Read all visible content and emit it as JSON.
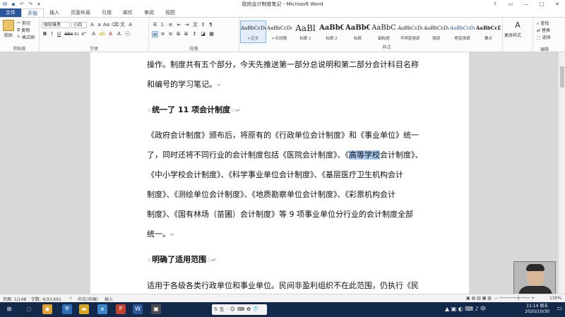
{
  "window": {
    "title": "政府会计制度笔记 - Microsoft Word",
    "controls": [
      "?",
      "▭",
      "—",
      "□",
      "✕"
    ]
  },
  "ribbon_tabs": [
    "文件",
    "开始",
    "插入",
    "页面布局",
    "引用",
    "邮件",
    "审阅",
    "视图"
  ],
  "clipboard": {
    "paste": "粘贴",
    "cut": "剪切",
    "copy": "复制",
    "format_painter": "格式刷",
    "group_label": "剪贴板"
  },
  "font": {
    "name": "微软雅黑",
    "size": "小四",
    "group_label": "字体"
  },
  "paragraph": {
    "group_label": "段落"
  },
  "styles": {
    "items": [
      {
        "sample": "AaBbCcDd",
        "name": "↵正文"
      },
      {
        "sample": "AaBbCcDd",
        "name": "↵无间隔"
      },
      {
        "sample": "AaBl",
        "name": "标题 1"
      },
      {
        "sample": "AaBbC",
        "name": "标题 2"
      },
      {
        "sample": "AaBbC",
        "name": "标题"
      },
      {
        "sample": "AaBbC",
        "name": "副标题"
      },
      {
        "sample": "AaBbCcDd",
        "name": "不明显强调"
      },
      {
        "sample": "AaBbCcDd",
        "name": "强调"
      },
      {
        "sample": "AaBbCcDc",
        "name": "明显强调"
      },
      {
        "sample": "AaBbCcDd",
        "name": "要点"
      }
    ],
    "change_styles": "更改样式",
    "group_label": "样式"
  },
  "editing": {
    "find": "查找",
    "replace": "替换",
    "select": "选择",
    "group_label": "编辑"
  },
  "document": {
    "lines": [
      {
        "text": "操作。制度共有五个部分，今天先推送第一部分总说明和第二部分会计科目名称"
      },
      {
        "text": "和编号的学习笔记。",
        "mark": "↵"
      },
      {
        "text": "统一了 11 项会计制度",
        "lead": "☆",
        "trail": "☆",
        "mark": "↵"
      },
      {
        "text": "《政府会计制度》颁布后，将原有的《行政单位会计制度》和《事业单位》统一"
      },
      {
        "before": "了，同时还将不同行业的会计制度包括《医院会计制度》、《",
        "highlight": "高等学校",
        "after": "会计制度》、"
      },
      {
        "text": "《中小学校会计制度》、《科学事业单位会计制度》、《基层医疗卫生机构会计"
      },
      {
        "text": "制度》、《测绘单位会计制度》、《地质勘察单位会计制度》、《彩票机构会计"
      },
      {
        "text": "制度》、《国有林场（苗圃）会计制度》等 9 项事业单位分行业的会计制度全部"
      },
      {
        "text": "统一。",
        "mark": "↵"
      },
      {
        "text": "明确了适用范围",
        "lead": "☆",
        "trail": "☆",
        "mark": "↵"
      },
      {
        "text": "适用于各级各类行政单位和事业单位。民间非盈利组织不在此范围，仍执行《民"
      }
    ]
  },
  "status_bar": {
    "page": "页面: 1/148",
    "words": "字数: 4/33,691",
    "language": "中文(中国)",
    "mode": "插入",
    "zoom": "130%"
  },
  "taskbar": {
    "time": "11:14 周五",
    "date": "2020/10/30"
  }
}
